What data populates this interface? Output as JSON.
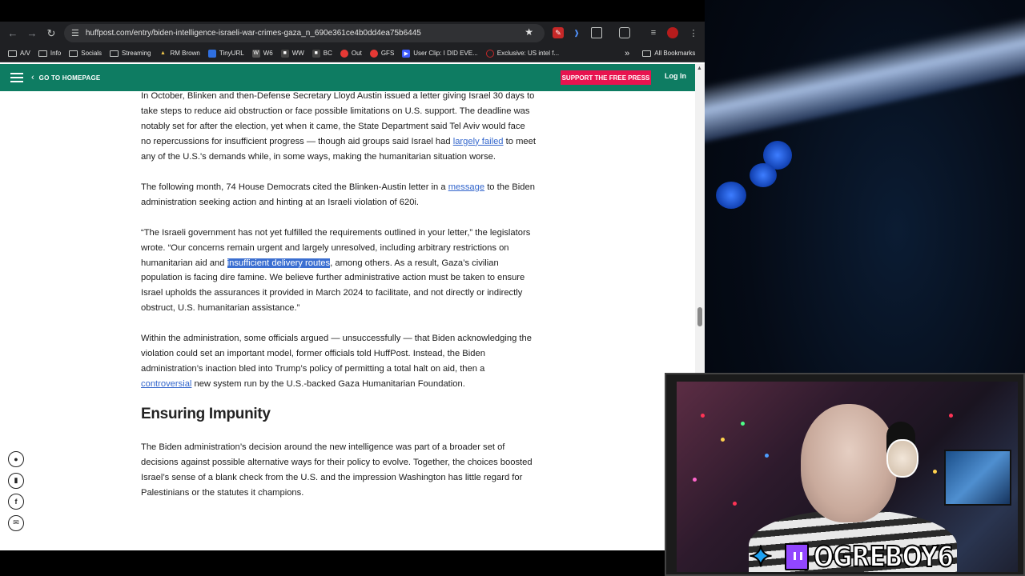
{
  "browser": {
    "url": "huffpost.com/entry/biden-intelligence-israeli-war-crimes-gaza_n_690e361ce4b0dd4ea75b6445",
    "bookmarks": [
      "A/V",
      "Info",
      "Socials",
      "Streaming",
      "RM Brown",
      "TinyURL",
      "W6",
      "WW",
      "BC",
      "Out",
      "GFS",
      "User Clip: I DID EVE...",
      "Exclusive: US intel f..."
    ],
    "all_bookmarks_label": "All Bookmarks"
  },
  "site": {
    "goto_home_label": "GO TO HOMEPAGE",
    "support_label": "SUPPORT THE FREE PRESS",
    "login_label": "Log In"
  },
  "article": {
    "p1": {
      "text_before": "In October, Blinken and then-Defense Secretary Lloyd Austin issued a letter giving Israel 30 days to take steps to reduce aid obstruction or face possible limitations on U.S. support. The deadline was notably set for after the election, yet when it came, the State Department said Tel Aviv would face no repercussions for insufficient progress — though aid groups said Israel had ",
      "link": "largely failed",
      "text_after": " to meet any of the U.S.'s demands while, in some ways, making the humanitarian situation worse."
    },
    "p2": {
      "text_before": "The following month, 74 House Democrats cited the Blinken-Austin letter in a ",
      "link": "message",
      "text_after": " to the Biden administration seeking action and hinting at an Israeli violation of 620i."
    },
    "p3": {
      "text_before": "“The Israeli government has not yet fulfilled the requirements outlined in your letter,” the legislators wrote. “Our concerns remain urgent and largely unresolved, including arbitrary restrictions on humanitarian aid and ",
      "highlight": "insufficient delivery routes",
      "text_after": ", among others. As a result, Gaza’s civilian population is facing dire famine. We believe further administrative action must be taken to ensure Israel upholds the assurances it provided in March 2024 to facilitate, and not directly or indirectly obstruct, U.S. humanitarian assistance.”"
    },
    "p4": {
      "text_before": "Within the administration, some officials argued — unsuccessfully — that Biden acknowledging the violation could set an important model, former officials told HuffPost. Instead, the Biden administration’s inaction bled into Trump’s policy of permitting a total halt on aid, then a ",
      "link": "controversial",
      "text_after": " new system run by the U.S.-backed Gaza Humanitarian Foundation."
    },
    "heading": "Ensuring Impunity",
    "p5": "The Biden administration’s decision around the new intelligence was part of a broader set of decisions against possible alternative ways for their policy to evolve. Together, the choices boosted Israel’s sense of a blank check from the U.S. and the impression Washington has little regard for Palestinians or the statutes it champions."
  },
  "share_icons": [
    "comment-icon",
    "bookmark-icon",
    "facebook-icon",
    "email-icon"
  ],
  "overlay": {
    "channel_name": "OGREBOY6"
  },
  "colors": {
    "header_green": "#0e7c62",
    "support_red": "#e8134f",
    "link_blue": "#3366cc",
    "highlight_blue": "#3b6fd1",
    "twitch_purple": "#9146ff",
    "twitter_blue": "#1da1f2"
  }
}
